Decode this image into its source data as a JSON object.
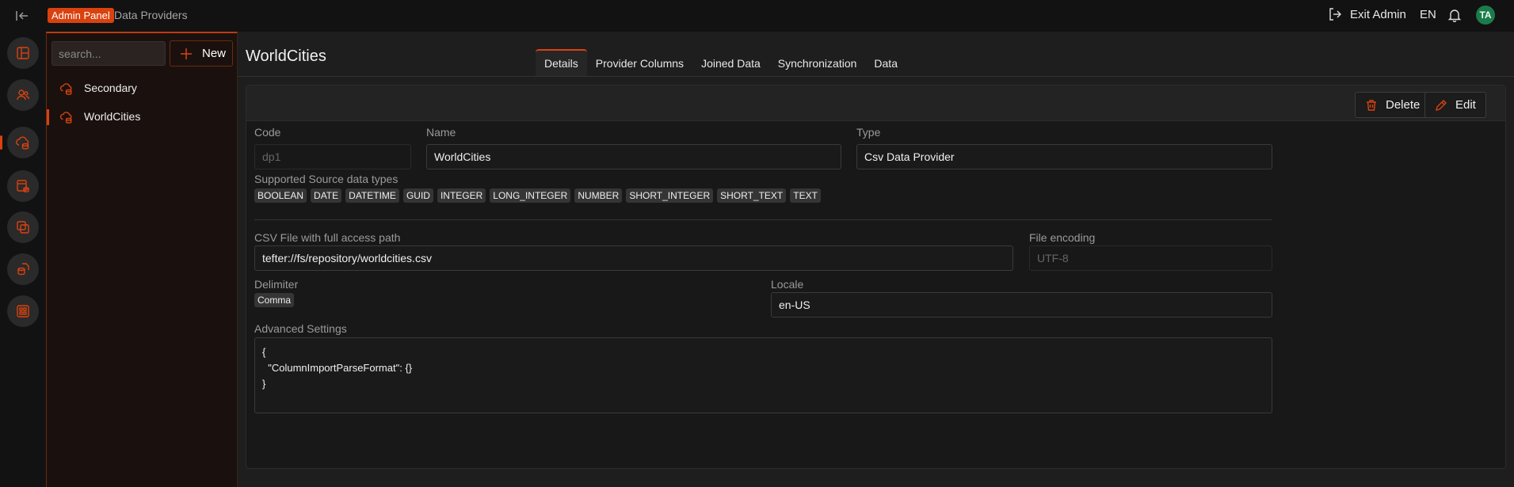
{
  "topbar": {
    "admin_badge": "Admin Panel",
    "breadcrumb": "Data Providers",
    "exit_label": "Exit Admin",
    "language": "EN",
    "avatar_initials": "TA"
  },
  "sidebar": {
    "search_placeholder": "search...",
    "new_label": "New",
    "items": [
      {
        "label": "Secondary"
      },
      {
        "label": "WorldCities"
      }
    ]
  },
  "main": {
    "title": "WorldCities",
    "tabs": [
      {
        "label": "Details"
      },
      {
        "label": "Provider Columns"
      },
      {
        "label": "Joined Data"
      },
      {
        "label": "Synchronization"
      },
      {
        "label": "Data"
      }
    ],
    "delete_label": "Delete",
    "edit_label": "Edit",
    "fields": {
      "code_label": "Code",
      "code_value": "dp1",
      "name_label": "Name",
      "name_value": "WorldCities",
      "type_label": "Type",
      "type_value": "Csv Data Provider",
      "types_label": "Supported Source data types",
      "types": [
        "BOOLEAN",
        "DATE",
        "DATETIME",
        "GUID",
        "INTEGER",
        "LONG_INTEGER",
        "NUMBER",
        "SHORT_INTEGER",
        "SHORT_TEXT",
        "TEXT"
      ],
      "csv_label": "CSV File with full access path",
      "csv_value": "tefter://fs/repository/worldcities.csv",
      "encoding_label": "File encoding",
      "encoding_value": "UTF-8",
      "delimiter_label": "Delimiter",
      "delimiter_value": "Comma",
      "locale_label": "Locale",
      "locale_value": "en-US",
      "advanced_label": "Advanced Settings",
      "advanced_value": "{\n  \"ColumnImportParseFormat\": {}\n}"
    }
  },
  "colors": {
    "accent": "#d9420f",
    "avatar_bg": "#1d7a4b"
  }
}
